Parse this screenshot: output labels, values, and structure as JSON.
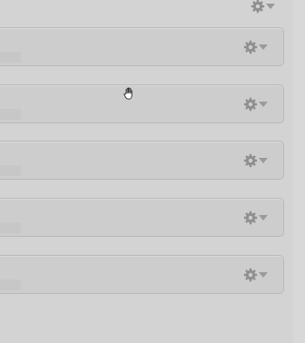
{
  "panels": [
    {
      "menu_icon": "gear-icon"
    },
    {
      "menu_icon": "gear-icon"
    },
    {
      "menu_icon": "gear-icon"
    },
    {
      "menu_icon": "gear-icon"
    },
    {
      "menu_icon": "gear-icon"
    }
  ],
  "header": {
    "menu_icon": "gear-icon"
  },
  "cursor": "hand-cursor-icon",
  "colors": {
    "background": "#d3d3d3",
    "panel": "#cdcdcd",
    "panel_border": "#b9b9b9",
    "icon": "#8f8f8f"
  }
}
